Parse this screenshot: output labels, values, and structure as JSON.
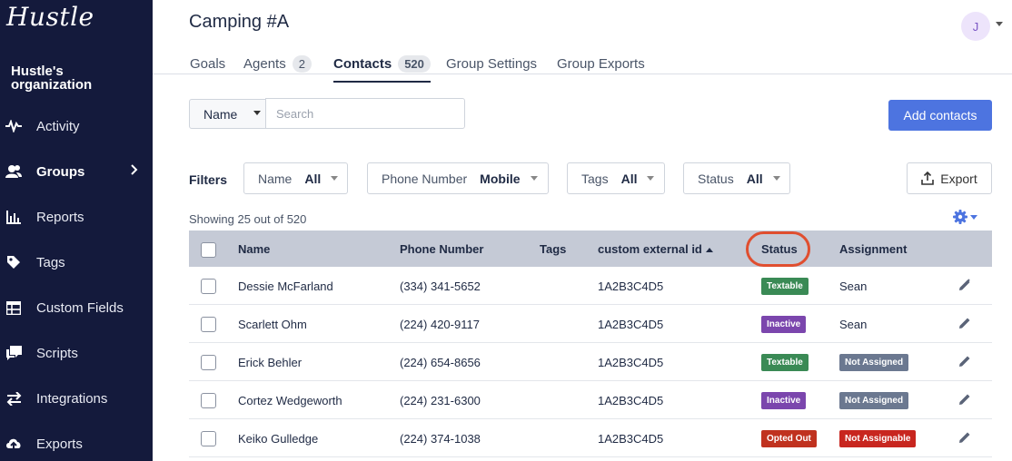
{
  "brand": {
    "logo": "Hustle",
    "org_name": "Hustle's organization"
  },
  "sidebar": {
    "items": [
      {
        "label": "Activity",
        "icon": "activity-icon"
      },
      {
        "label": "Groups",
        "icon": "groups-icon",
        "active": true
      },
      {
        "label": "Reports",
        "icon": "reports-icon"
      },
      {
        "label": "Tags",
        "icon": "tag-icon"
      },
      {
        "label": "Custom Fields",
        "icon": "custom-fields-icon"
      },
      {
        "label": "Scripts",
        "icon": "scripts-icon"
      },
      {
        "label": "Integrations",
        "icon": "integrations-icon"
      },
      {
        "label": "Exports",
        "icon": "exports-icon"
      }
    ]
  },
  "header": {
    "title": "Camping #A",
    "avatar_initial": "J"
  },
  "tabs": [
    {
      "label": "Goals"
    },
    {
      "label": "Agents",
      "count": "2"
    },
    {
      "label": "Contacts",
      "count": "520",
      "active": true
    },
    {
      "label": "Group Settings"
    },
    {
      "label": "Group Exports"
    }
  ],
  "search": {
    "field_select": "Name",
    "placeholder": "Search",
    "value": ""
  },
  "add_contacts_label": "Add contacts",
  "filters": {
    "label": "Filters",
    "items": [
      {
        "name": "Name",
        "value": "All"
      },
      {
        "name": "Phone Number",
        "value": "Mobile"
      },
      {
        "name": "Tags",
        "value": "All"
      },
      {
        "name": "Status",
        "value": "All"
      }
    ],
    "export_label": "Export"
  },
  "showing": "Showing 25 out of 520",
  "table": {
    "columns": [
      "Name",
      "Phone Number",
      "Tags",
      "custom external id",
      "Status",
      "Assignment"
    ],
    "rows": [
      {
        "name": "Dessie McFarland",
        "phone": "(334) 341-5652",
        "tags": "",
        "external_id": "1A2B3C4D5",
        "status": "Textable",
        "assignment": "Sean",
        "assignment_badge": false
      },
      {
        "name": "Scarlett Ohm",
        "phone": "(224) 420-9117",
        "tags": "",
        "external_id": "1A2B3C4D5",
        "status": "Inactive",
        "assignment": "Sean",
        "assignment_badge": false
      },
      {
        "name": "Erick Behler",
        "phone": "(224) 654-8656",
        "tags": "",
        "external_id": "1A2B3C4D5",
        "status": "Textable",
        "assignment": "Not Assigned",
        "assignment_badge": true
      },
      {
        "name": "Cortez Wedgeworth",
        "phone": "(224) 231-6300",
        "tags": "",
        "external_id": "1A2B3C4D5",
        "status": "Inactive",
        "assignment": "Not Assigned",
        "assignment_badge": true
      },
      {
        "name": "Keiko Gulledge",
        "phone": "(224) 374-1038",
        "tags": "",
        "external_id": "1A2B3C4D5",
        "status": "Opted Out",
        "assignment": "Not Assignable",
        "assignment_badge": true
      }
    ]
  },
  "colors": {
    "sidebar_bg": "#141a3c",
    "accent": "#4d74e0",
    "status_textable": "#3a8a55",
    "status_inactive": "#7b46ad",
    "status_opted_out": "#c0321f",
    "assign_not_assigned": "#6b7890",
    "assign_not_assignable": "#c8261f",
    "highlight_circle": "#e04e2f"
  }
}
